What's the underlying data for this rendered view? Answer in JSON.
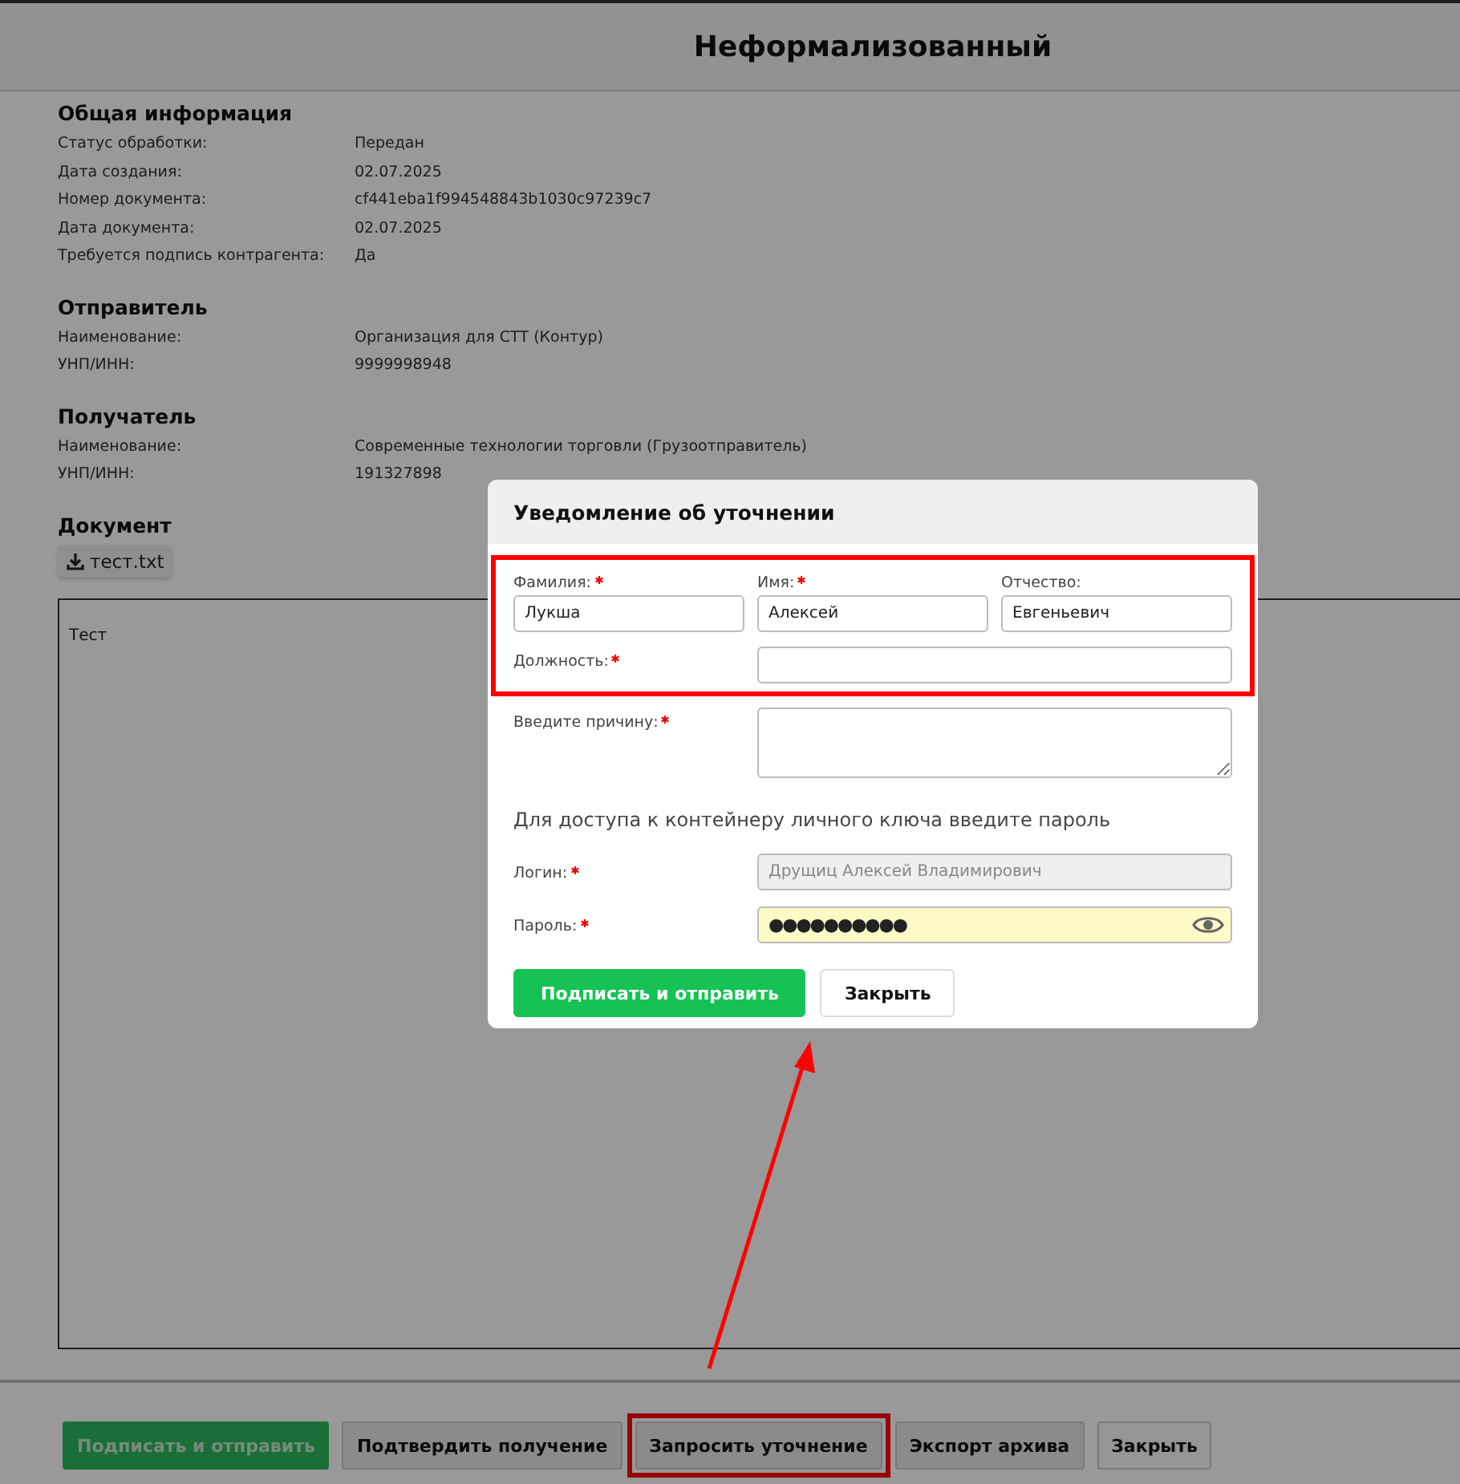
{
  "header": {
    "title": "Неформализованный"
  },
  "sections": [
    {
      "title": "Общая информация",
      "rows": [
        {
          "label": "Статус обработки:",
          "value": "Передан"
        },
        {
          "label": "Дата создания:",
          "value": "02.07.2025"
        },
        {
          "label": "Номер документа:",
          "value": "cf441eba1f994548843b1030c97239c7"
        },
        {
          "label": "Дата документа:",
          "value": "02.07.2025"
        },
        {
          "label": "Требуется подпись контрагента:",
          "value": "Да"
        }
      ]
    },
    {
      "title": "Отправитель",
      "rows": [
        {
          "label": "Наименование:",
          "value": "Организация для СТТ (Контур)"
        },
        {
          "label": "УНП/ИНН:",
          "value": "9999998948"
        }
      ]
    },
    {
      "title": "Получатель",
      "rows": [
        {
          "label": "Наименование:",
          "value": "Современные технологии торговли (Грузоотправитель)"
        },
        {
          "label": "УНП/ИНН:",
          "value": "191327898"
        }
      ]
    }
  ],
  "document": {
    "title": "Документ",
    "file": "тест.txt",
    "content": "Тест"
  },
  "footer_buttons": [
    {
      "label": "Подписать и отправить",
      "kind": "primary",
      "highlighted": false
    },
    {
      "label": "Подтвердить получение",
      "kind": "secondary",
      "highlighted": false
    },
    {
      "label": "Запросить уточнение",
      "kind": "secondary",
      "highlighted": true
    },
    {
      "label": "Экспорт архива",
      "kind": "secondary",
      "highlighted": false
    },
    {
      "label": "Закрыть",
      "kind": "plain",
      "highlighted": false
    }
  ],
  "dialog": {
    "title": "Уведомление об уточнении",
    "identity": {
      "highlighted": true,
      "name_fields": [
        {
          "label": "Фамилия:",
          "required": true,
          "value": "Лукша"
        },
        {
          "label": "Имя:",
          "required": true,
          "value": "Алексей"
        },
        {
          "label": "Отчество:",
          "required": false,
          "value": "Евгеньевич"
        }
      ],
      "position": {
        "label": "Должность:",
        "required": true
      }
    },
    "reason": {
      "label": "Введите причину:",
      "required": true
    },
    "key_section": {
      "title": "Для доступа к контейнеру личного ключа введите пароль",
      "login": {
        "label": "Логин:",
        "required": true,
        "value": "Друщиц Алексей Владимирович",
        "disabled": true
      },
      "password": {
        "label": "Пароль:",
        "required": true,
        "value": "●●●●●●●●●●"
      }
    },
    "buttons": [
      {
        "label": "Подписать и отправить",
        "kind": "primary"
      },
      {
        "label": "Закрыть",
        "kind": "plain"
      }
    ]
  }
}
